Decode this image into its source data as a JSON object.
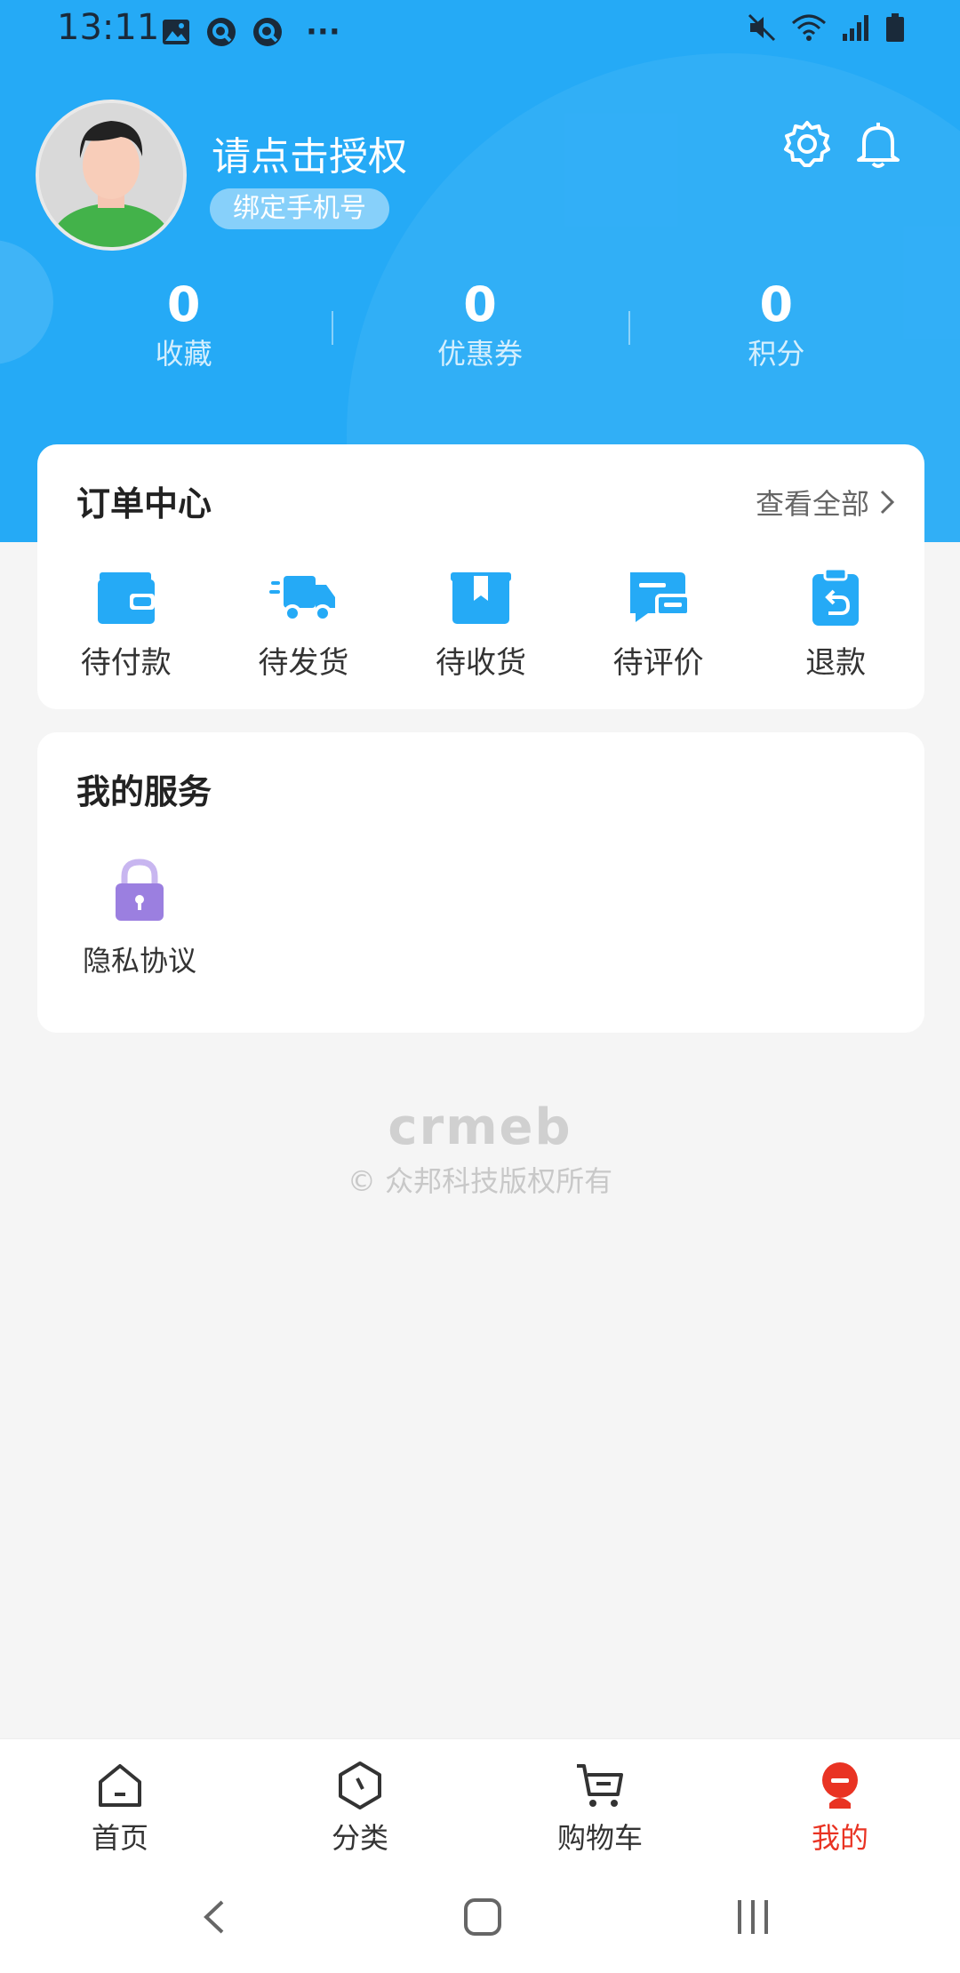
{
  "status_bar": {
    "time": "13:11",
    "left_icons": [
      "image-icon",
      "q-app-icon",
      "q-app-icon",
      "more-dots-icon"
    ],
    "right_icons": [
      "mute-icon",
      "wifi-icon",
      "signal-icon",
      "battery-icon"
    ],
    "more_glyph": "···"
  },
  "profile": {
    "username": "请点击授权",
    "bind_phone_label": "绑定手机号"
  },
  "stats": [
    {
      "value": "0",
      "label": "收藏"
    },
    {
      "value": "0",
      "label": "优惠券"
    },
    {
      "value": "0",
      "label": "积分"
    }
  ],
  "orders": {
    "title": "订单中心",
    "view_all": "查看全部",
    "items": [
      {
        "label": "待付款",
        "icon": "wallet-icon"
      },
      {
        "label": "待发货",
        "icon": "truck-icon"
      },
      {
        "label": "待收货",
        "icon": "package-icon"
      },
      {
        "label": "待评价",
        "icon": "review-icon"
      },
      {
        "label": "退款",
        "icon": "refund-icon"
      }
    ]
  },
  "services": {
    "title": "我的服务",
    "items": [
      {
        "label": "隐私协议",
        "icon": "lock-icon"
      }
    ]
  },
  "footer": {
    "brand": "crmeb",
    "copyright": "© 众邦科技版权所有"
  },
  "tabbar": [
    {
      "label": "首页",
      "icon": "home-icon",
      "active": false
    },
    {
      "label": "分类",
      "icon": "category-icon",
      "active": false
    },
    {
      "label": "购物车",
      "icon": "cart-icon",
      "active": false
    },
    {
      "label": "我的",
      "icon": "profile-icon",
      "active": true
    }
  ],
  "colors": {
    "primary": "#25aaf6",
    "active_tab": "#e93323",
    "lock": "#9b7fe0"
  }
}
